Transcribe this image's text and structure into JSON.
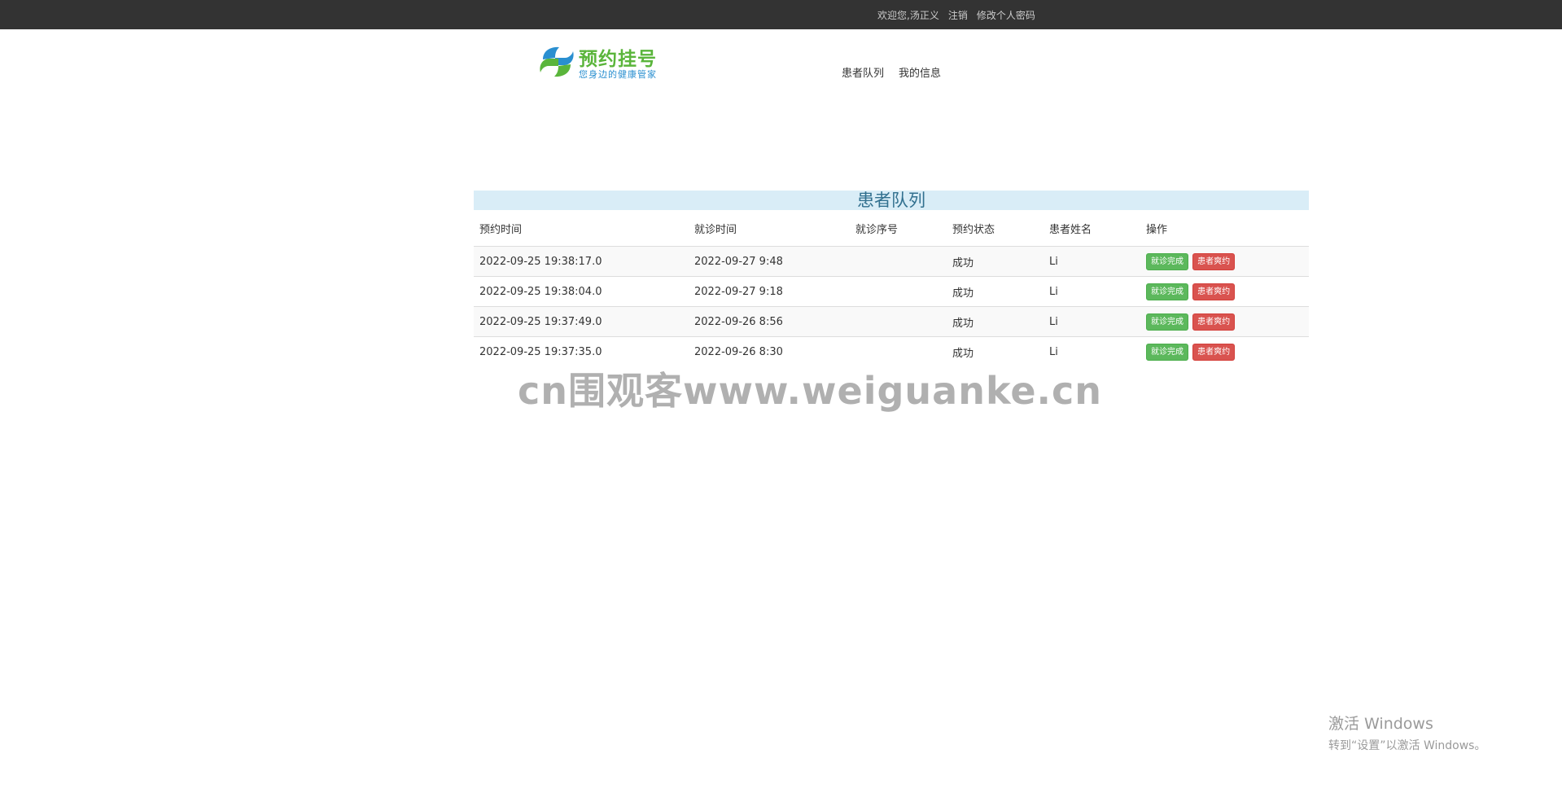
{
  "topbar": {
    "welcome": "欢迎您,汤正义",
    "logout": "注销",
    "change_password": "修改个人密码"
  },
  "logo": {
    "title": "预约挂号",
    "subtitle": "您身边的健康管家"
  },
  "nav": {
    "items": [
      "患者队列",
      "我的信息"
    ]
  },
  "panel": {
    "title": "患者队列"
  },
  "table": {
    "headers": [
      "预约时间",
      "就诊时间",
      "就诊序号",
      "预约状态",
      "患者姓名",
      "操作"
    ],
    "rows": [
      {
        "booking_time": "2022-09-25 19:38:17.0",
        "visit_time": "2022-09-27 9:48",
        "seq": "",
        "status": "成功",
        "name": "Li",
        "btn_done": "就诊完成",
        "btn_noshow": "患者爽约"
      },
      {
        "booking_time": "2022-09-25 19:38:04.0",
        "visit_time": "2022-09-27 9:18",
        "seq": "",
        "status": "成功",
        "name": "Li",
        "btn_done": "就诊完成",
        "btn_noshow": "患者爽约"
      },
      {
        "booking_time": "2022-09-25 19:37:49.0",
        "visit_time": "2022-09-26 8:56",
        "seq": "",
        "status": "成功",
        "name": "Li",
        "btn_done": "就诊完成",
        "btn_noshow": "患者爽约"
      },
      {
        "booking_time": "2022-09-25 19:37:35.0",
        "visit_time": "2022-09-26 8:30",
        "seq": "",
        "status": "成功",
        "name": "Li",
        "btn_done": "就诊完成",
        "btn_noshow": "患者爽约"
      }
    ]
  },
  "watermark": "cn围观客www.weiguanke.cn",
  "windows_activation": {
    "line1": "激活 Windows",
    "line2": "转到“设置”以激活 Windows。"
  },
  "colors": {
    "topbar_bg": "#333333",
    "panel_title_bg": "#d9edf7",
    "panel_title_text": "#31708f",
    "success_button": "#5cb85c",
    "danger_button": "#d9534f",
    "logo_green": "#5ab53b",
    "logo_blue": "#2a8fd0"
  }
}
